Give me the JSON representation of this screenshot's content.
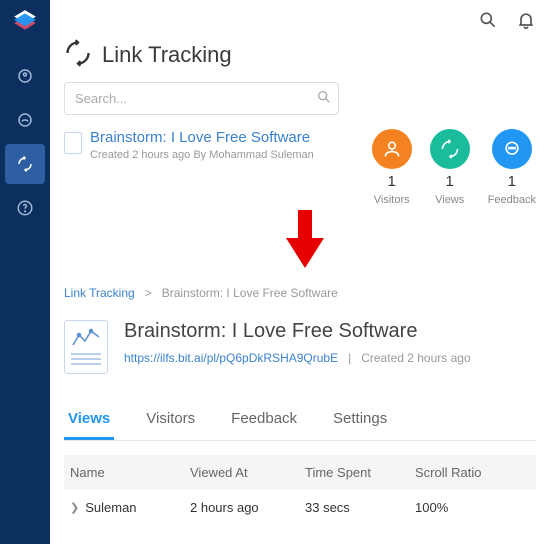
{
  "page": {
    "title": "Link Tracking"
  },
  "search": {
    "placeholder": "Search..."
  },
  "doc": {
    "title": "Brainstorm: I Love Free Software",
    "meta": "Created 2 hours ago By Mohammad Suleman"
  },
  "stats": {
    "visitors": {
      "num": "1",
      "label": "Visitors"
    },
    "views": {
      "num": "1",
      "label": "Views"
    },
    "feedback": {
      "num": "1",
      "label": "Feedback"
    }
  },
  "breadcrumb": {
    "root": "Link Tracking",
    "sep": ">",
    "current": "Brainstorm: I Love Free Software"
  },
  "detail": {
    "title": "Brainstorm: I Love Free Software",
    "url": "https://ilfs.bit.ai/pl/pQ6pDkRSHA9QrubE",
    "created": "Created 2 hours ago"
  },
  "tabs": {
    "views": "Views",
    "visitors": "Visitors",
    "feedback": "Feedback",
    "settings": "Settings"
  },
  "table": {
    "headers": {
      "name": "Name",
      "viewed_at": "Viewed At",
      "time_spent": "Time Spent",
      "scroll": "Scroll Ratio"
    },
    "row": {
      "name": "Suleman",
      "viewed_at": "2 hours ago",
      "time_spent": "33 secs",
      "scroll": "100%"
    }
  }
}
